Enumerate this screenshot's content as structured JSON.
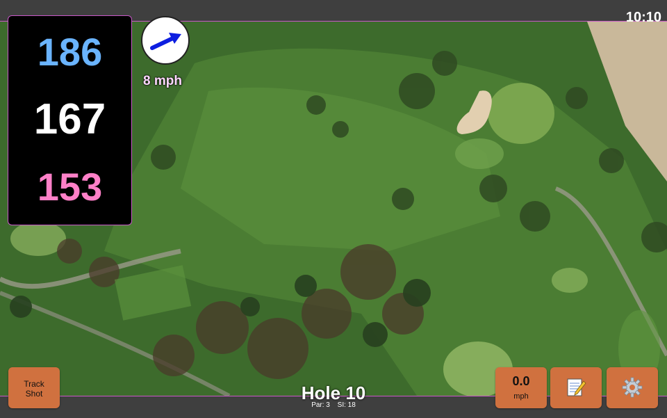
{
  "status_bar": {
    "time": "10:10"
  },
  "distances": {
    "back": "186",
    "middle": "167",
    "front": "153"
  },
  "wind": {
    "speed_label": "8 mph",
    "direction_icon": "wind-arrow-icon"
  },
  "hole": {
    "title": "Hole 10",
    "par": "Par: 3",
    "si": "SI: 18"
  },
  "buttons": {
    "track_shot_line1": "Track",
    "track_shot_line2": "Shot",
    "wind_value": "0.0",
    "wind_unit": "mph",
    "notes_icon": "notepad-icon",
    "settings_icon": "gear-icon"
  },
  "colors": {
    "back_distance": "#6ab4ff",
    "middle_distance": "#ffffff",
    "front_distance": "#ff80c8",
    "button": "#d0713f",
    "accent_border": "#c858c8"
  }
}
